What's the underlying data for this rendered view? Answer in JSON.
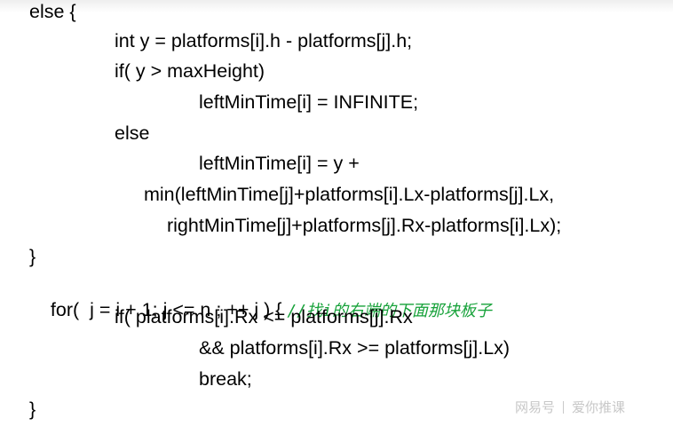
{
  "code": {
    "lines": [
      "else {",
      "int y = platforms[i].h - platforms[j].h;",
      "if( y > maxHeight)",
      "leftMinTime[i] = INFINITE;",
      "else",
      "leftMinTime[i] = y +",
      "min(leftMinTime[j]+platforms[i].Lx-platforms[j].Lx,",
      "rightMinTime[j]+platforms[j].Rx-platforms[i].Lx);",
      "}",
      "for(  j = i + 1; j <= n ; ++ j ) {",
      "if( platforms[i].Rx <= platforms[j].Rx",
      "&& platforms[i].Rx >= platforms[j].Lx)",
      "break;",
      "}"
    ],
    "comment": "//找i的右端的下面那块板子"
  },
  "watermark": {
    "brand": "网易号",
    "author": "爱你推课"
  },
  "colors": {
    "code_text": "#000000",
    "comment": "#17a23a"
  }
}
